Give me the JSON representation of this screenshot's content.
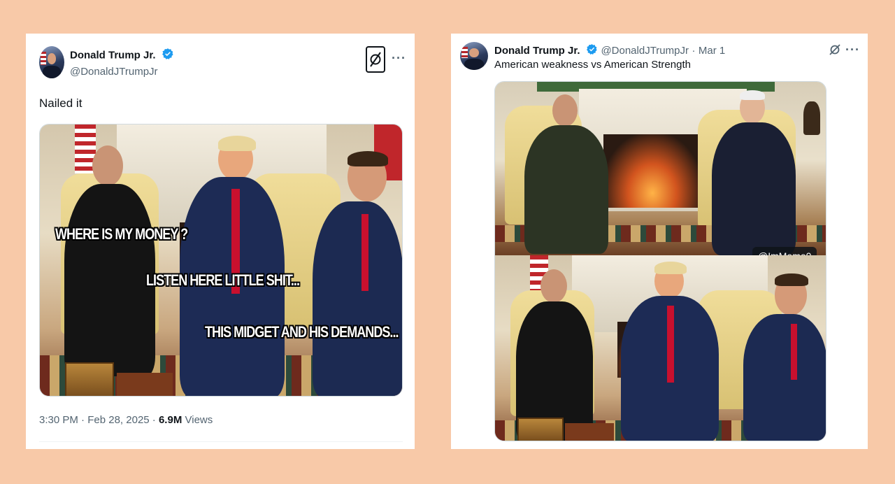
{
  "left_tweet": {
    "author_name": "Donald Trump Jr.",
    "author_handle": "@DonaldJTrumpJr",
    "text": "Nailed it",
    "meme_captions": [
      "WHERE IS MY MONEY ?",
      "LISTEN HERE LITTLE SHIT...",
      "THIS MIDGET AND HIS DEMANDS..."
    ],
    "time": "3:30 PM",
    "date": "Feb 28, 2025",
    "separator": "·",
    "views_count": "6.9M",
    "views_label": "Views"
  },
  "right_tweet": {
    "author_name": "Donald Trump Jr.",
    "author_handle": "@DonaldJTrumpJr",
    "date": "Mar 1",
    "separator": "·",
    "text": "American weakness vs American Strength",
    "watermark": "@ImMeme0"
  },
  "icons": {
    "verified": "verified-badge-icon",
    "grok": "grok-icon",
    "more": "more-options-icon"
  },
  "colors": {
    "background": "#f8c9a8",
    "verified_blue": "#1d9bf0",
    "text_primary": "#0f1419",
    "text_secondary": "#536471"
  }
}
